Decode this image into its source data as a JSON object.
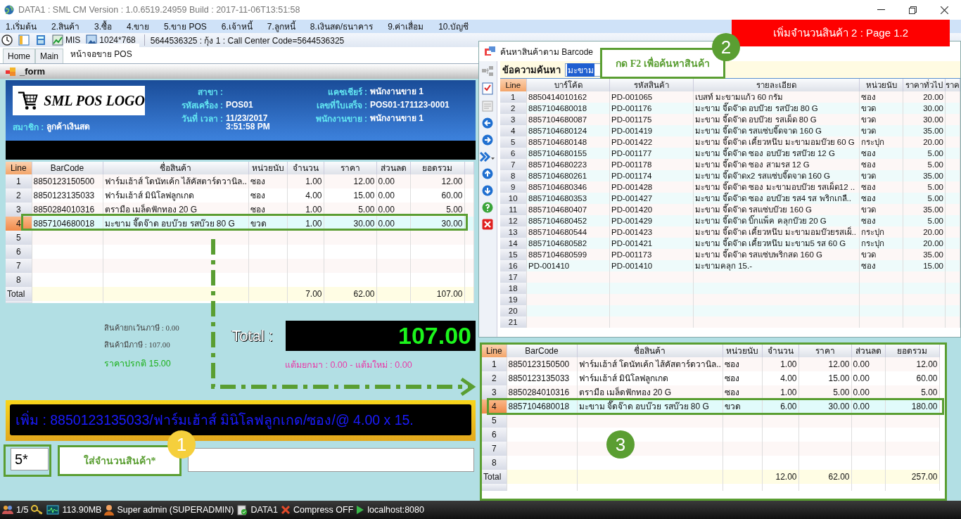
{
  "window": {
    "title": "DATA1 : SML CM Version : 1.0.6519.24959  Build : 2017-11-06T13:51:58"
  },
  "menu": [
    "1.เริ่มต้น",
    "2.สินค้า",
    "3.ซื้อ",
    "4.ขาย",
    "5.ขาย POS",
    "6.เจ้าหนี้",
    "7.ลูกหนี้",
    "8.เงินสด/ธนาคาร",
    "9.ค่าเสื่อม",
    "10.บัญชี"
  ],
  "banner": "เพิ่มจำนวนสินค้า 2 : Page 1.2",
  "toolbar": {
    "items": [
      {
        "kind": "clock"
      },
      {
        "kind": "panel"
      },
      {
        "kind": "calculator"
      },
      {
        "kind": "chart",
        "label": "MIS"
      },
      {
        "kind": "image",
        "label": "1024*768"
      }
    ],
    "info": "5644536325 : กุ้ง 1 : Call Center Code=5644536325"
  },
  "tabs": [
    {
      "label": "Home",
      "selected": false
    },
    {
      "label": "Main",
      "selected": false
    },
    {
      "label": "หน้าจอขาย POS",
      "selected": true
    }
  ],
  "form_title": "_form",
  "pos_header": {
    "logo": "SML POS LOGO",
    "member": {
      "label": "สมาชิก :",
      "value": "ลูกค้าเงินสด"
    },
    "columns": [
      {
        "fields": [
          {
            "label": "สาขา :"
          },
          {
            "label": "รหัสเครื่อง :",
            "values": [
              "POS01"
            ]
          },
          {
            "label": "วันที่ เวลา :",
            "values": [
              "11/23/2017",
              "3:51:58 PM"
            ]
          }
        ]
      },
      {
        "fields": [
          {
            "label": "แคชเชียร์ :",
            "values": [
              "พนักงานขาย 1"
            ]
          },
          {
            "label": "เลขที่ใบเสร็จ :",
            "values": [
              "POS01-171123-0001"
            ]
          },
          {
            "label": "พนักงานขาย :",
            "values": [
              "พนักงานขาย 1"
            ]
          }
        ]
      }
    ]
  },
  "sale_table": {
    "columns": [
      "Line",
      "BarCode",
      "ชื่อสินค้า",
      "หน่วยนับ",
      "จำนวน",
      "ราคา",
      "ส่วนลด",
      "ยอดรวม"
    ],
    "rows": [
      {
        "selected": false,
        "cells": [
          "1",
          "8850123150500",
          "ฟาร์มเฮ้าส์  โดนัทเค้ก ไส้คัสตาร์ดวานิล..",
          "ซอง",
          "1.00",
          "12.00",
          "0.00",
          "12.00"
        ]
      },
      {
        "selected": false,
        "cells": [
          "2",
          "8850123135033",
          "ฟาร์มเฮ้าส์  มินิโลฟลูกเกด",
          "ซอง",
          "4.00",
          "15.00",
          "0.00",
          "60.00"
        ]
      },
      {
        "selected": false,
        "cells": [
          "3",
          "8850284010316",
          "ตรามือ เมล็ดฟักทอง 20 G",
          "ซอง",
          "1.00",
          "5.00",
          "0.00",
          "5.00"
        ]
      },
      {
        "selected": true,
        "cells": [
          "4",
          "8857104680018",
          "มะขาม จี๊ดจ๊าด อบบ๊วย รสบ๊วย 80 G",
          "ขวด",
          "1.00",
          "30.00",
          "0.00",
          "30.00"
        ]
      }
    ],
    "empty_lines": [
      "5",
      "6",
      "7",
      "8"
    ],
    "total": {
      "label": "Total",
      "quantity": "7.00",
      "price": "62.00",
      "amount": "107.00"
    }
  },
  "summary": {
    "non_vat": "สินค้ายกเว้นภาษี : 0.00",
    "vat": "สินค้ามีภาษี : 107.00",
    "regular_price": "ราคาปรกติ 15.00",
    "total_label": "Total :",
    "total_value": "107.00",
    "points": "แต้มยกมา : 0.00 - แต้มใหม่ : 0.00"
  },
  "marquee": "เพิ่ม : 8850123135033/ฟาร์มเฮ้าส์  มินิโลฟลูกเกด/ซอง/@ 4.00 x 15.",
  "quantity_input": {
    "value": "5*"
  },
  "search_dialog": {
    "title": "ค้นหาสินค้าตาม Barcode",
    "search_label": "ข้อความค้นหา",
    "search_value": "มะขาม",
    "tools": [
      {
        "kind": "network"
      },
      {
        "kind": "checklist"
      },
      {
        "kind": "form"
      },
      {
        "kind": "back"
      },
      {
        "kind": "forward"
      },
      {
        "kind": "more"
      },
      {
        "kind": "up"
      },
      {
        "kind": "down"
      },
      {
        "kind": "help"
      },
      {
        "kind": "close"
      }
    ],
    "columns": [
      "Line",
      "บาร์โค้ด",
      "รหัสสินค้า",
      "รายละเอียด",
      "หน่วยนับ",
      "ราคาทั่วไป",
      "ราค"
    ],
    "rows": [
      {
        "cells": [
          "1",
          "8850414010162",
          "PD-001065",
          "เบสท์  มะขามแก้ว  60 กรัม",
          "ซอง",
          "20.00"
        ]
      },
      {
        "cells": [
          "2",
          "8857104680018",
          "PD-001176",
          "มะขาม จี๊ดจ๊าด อบบ๊วย รสบ๊วย 80 G",
          "ขวด",
          "30.00"
        ]
      },
      {
        "cells": [
          "3",
          "8857104680087",
          "PD-001175",
          "มะขาม จี๊ดจ๊าด อบบ๊วย รสเผ็ด 80 G",
          "ขวด",
          "30.00"
        ]
      },
      {
        "cells": [
          "4",
          "8857104680124",
          "PD-001419",
          "มะขาม จี๊ดจ๊าด รสแซ่บจี๊ดจาด 160 G",
          "ขวด",
          "35.00"
        ]
      },
      {
        "cells": [
          "5",
          "8857104680148",
          "PD-001422",
          "มะขาม จี๊ดจ๊าด เคี้ยวหนึบ มะขามอมบ๊วย 60 G",
          "กระปุก",
          "20.00"
        ]
      },
      {
        "cells": [
          "6",
          "8857104680155",
          "PD-001177",
          "มะขาม จี๊ดจ๊าด ซอง อบบ๊วย รสบ๊วย 12 G",
          "ซอง",
          "5.00"
        ]
      },
      {
        "cells": [
          "7",
          "8857104680223",
          "PD-001178",
          "มะขาม จี๊ดจ๊าด ซอง สามรส 12 G",
          "ซอง",
          "5.00"
        ]
      },
      {
        "cells": [
          "8",
          "8857104680261",
          "PD-001174",
          "มะขาม  จี๊ดจ๊าดx2 รสแซ่บจี๊ดจาด 160 G",
          "ขวด",
          "35.00"
        ]
      },
      {
        "cells": [
          "9",
          "8857104680346",
          "PD-001428",
          "มะขาม จี๊ดจ๊าด ซอง มะขามอบบ๊วย รสเผ็ด12 ..",
          "ซอง",
          "5.00"
        ]
      },
      {
        "cells": [
          "10",
          "8857104680353",
          "PD-001427",
          "มะขาม จี๊ดจ๊าด ซอง อบบ๊วย รส4 รส พริกเกลื..",
          "ซอง",
          "5.00"
        ]
      },
      {
        "cells": [
          "11",
          "8857104680407",
          "PD-001420",
          "มะขาม จี๊ดจ๊าด รสแซ่บบ๊วย 160 G",
          "ขวด",
          "35.00"
        ]
      },
      {
        "cells": [
          "12",
          "8857104680452",
          "PD-001429",
          "มะขาม จี๊ดจ๊าด บิ๊กแพ็ค คลุกบ๊วย 20 G",
          "ซอง",
          "5.00"
        ]
      },
      {
        "cells": [
          "13",
          "8857104680544",
          "PD-001423",
          "มะขาม จี๊ดจ๊าด เคี้ยวหนึบ มะขามอมบ๊วยรสเผ็..",
          "กระปุก",
          "20.00"
        ]
      },
      {
        "cells": [
          "14",
          "8857104680582",
          "PD-001421",
          "มะขาม จี๊ดจ๊าด เคี้ยวหนึบ มะขาม5 รส 60 G",
          "กระปุก",
          "20.00"
        ]
      },
      {
        "cells": [
          "15",
          "8857104680599",
          "PD-001173",
          "มะขาม จี๊ดจ๊าด รสแซ่บพริกสด 160 G",
          "ขวด",
          "35.00"
        ]
      },
      {
        "cells": [
          "16",
          "PD-001410",
          "PD-001410",
          "มะขามคลุก 15.-",
          "ซอง",
          "15.00"
        ]
      }
    ],
    "empty_lines": [
      "17",
      "18",
      "19",
      "20",
      "21"
    ]
  },
  "result_table": {
    "columns": [
      "Line",
      "BarCode",
      "ชื่อสินค้า",
      "หน่วยนับ",
      "จำนวน",
      "ราคา",
      "ส่วนลด",
      "ยอดรวม"
    ],
    "rows": [
      {
        "selected": false,
        "cells": [
          "1",
          "8850123150500",
          "ฟาร์มเฮ้าส์  โดนัทเค้ก ไส้คัสตาร์ดวานิล..",
          "ซอง",
          "1.00",
          "12.00",
          "0.00",
          "12.00"
        ]
      },
      {
        "selected": false,
        "cells": [
          "2",
          "8850123135033",
          "ฟาร์มเฮ้าส์  มินิโลฟลูกเกด",
          "ซอง",
          "4.00",
          "15.00",
          "0.00",
          "60.00"
        ]
      },
      {
        "selected": false,
        "cells": [
          "3",
          "8850284010316",
          "ตรามือ เมล็ดฟักทอง 20 G",
          "ซอง",
          "1.00",
          "5.00",
          "0.00",
          "5.00"
        ]
      },
      {
        "selected": true,
        "cells": [
          "4",
          "8857104680018",
          "มะขาม จี๊ดจ๊าด อบบ๊วย รสบ๊วย 80 G",
          "ขวด",
          "6.00",
          "30.00",
          "0.00",
          "180.00"
        ]
      }
    ],
    "empty_lines": [
      "5",
      "6",
      "7",
      "8"
    ],
    "total": {
      "label": "Total",
      "quantity": "12.00",
      "price": "62.00",
      "amount": "257.00"
    }
  },
  "annotations": {
    "markers": [
      "1",
      "2",
      "3"
    ],
    "notes": [
      "ใส่จำนวนสินค้า*",
      "กด F2 เพื่อค้นหาสินค้า"
    ]
  },
  "status_bar": [
    {
      "kind": "users",
      "text": "1/5"
    },
    {
      "kind": "key"
    },
    {
      "kind": "monitor",
      "text": "113.90MB"
    },
    {
      "kind": "user",
      "text": "Super admin (SUPERADMIN)"
    },
    {
      "kind": "database",
      "text": "DATA1"
    },
    {
      "kind": "cross",
      "text": "Compress OFF"
    },
    {
      "kind": "play",
      "text": "localhost:8080"
    }
  ]
}
